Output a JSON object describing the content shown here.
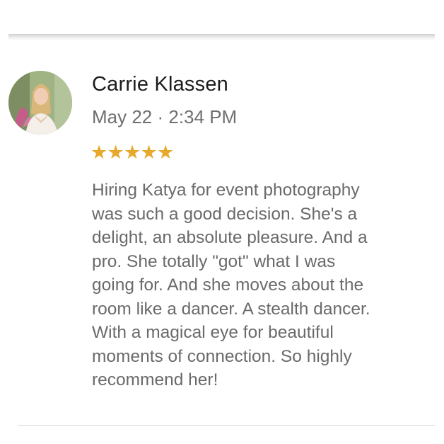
{
  "review": {
    "reviewer_name": "Carrie Klassen",
    "date": "May 22 · 2:34 PM",
    "rating": 5,
    "stars": [
      "★",
      "★",
      "★",
      "★",
      "★"
    ],
    "text": "Hiring Katya for event photography\nwas such a good decision. She's a\ndelight, an absolute pleasure. And a\npro. She totally \"got\" what I was\ngoing for. And she moves about the\nroom like a dancer. A stealth dancer.\nWith a magical eye for beautiful\nmoments of connection. So highly\nrecommend her!"
  },
  "colors": {
    "star": "#e7a92b",
    "name_text": "#1c1c1c",
    "secondary_text": "#6f6f6f",
    "divider": "#d7d7d7"
  },
  "icons": {
    "avatar": "user-photo"
  }
}
